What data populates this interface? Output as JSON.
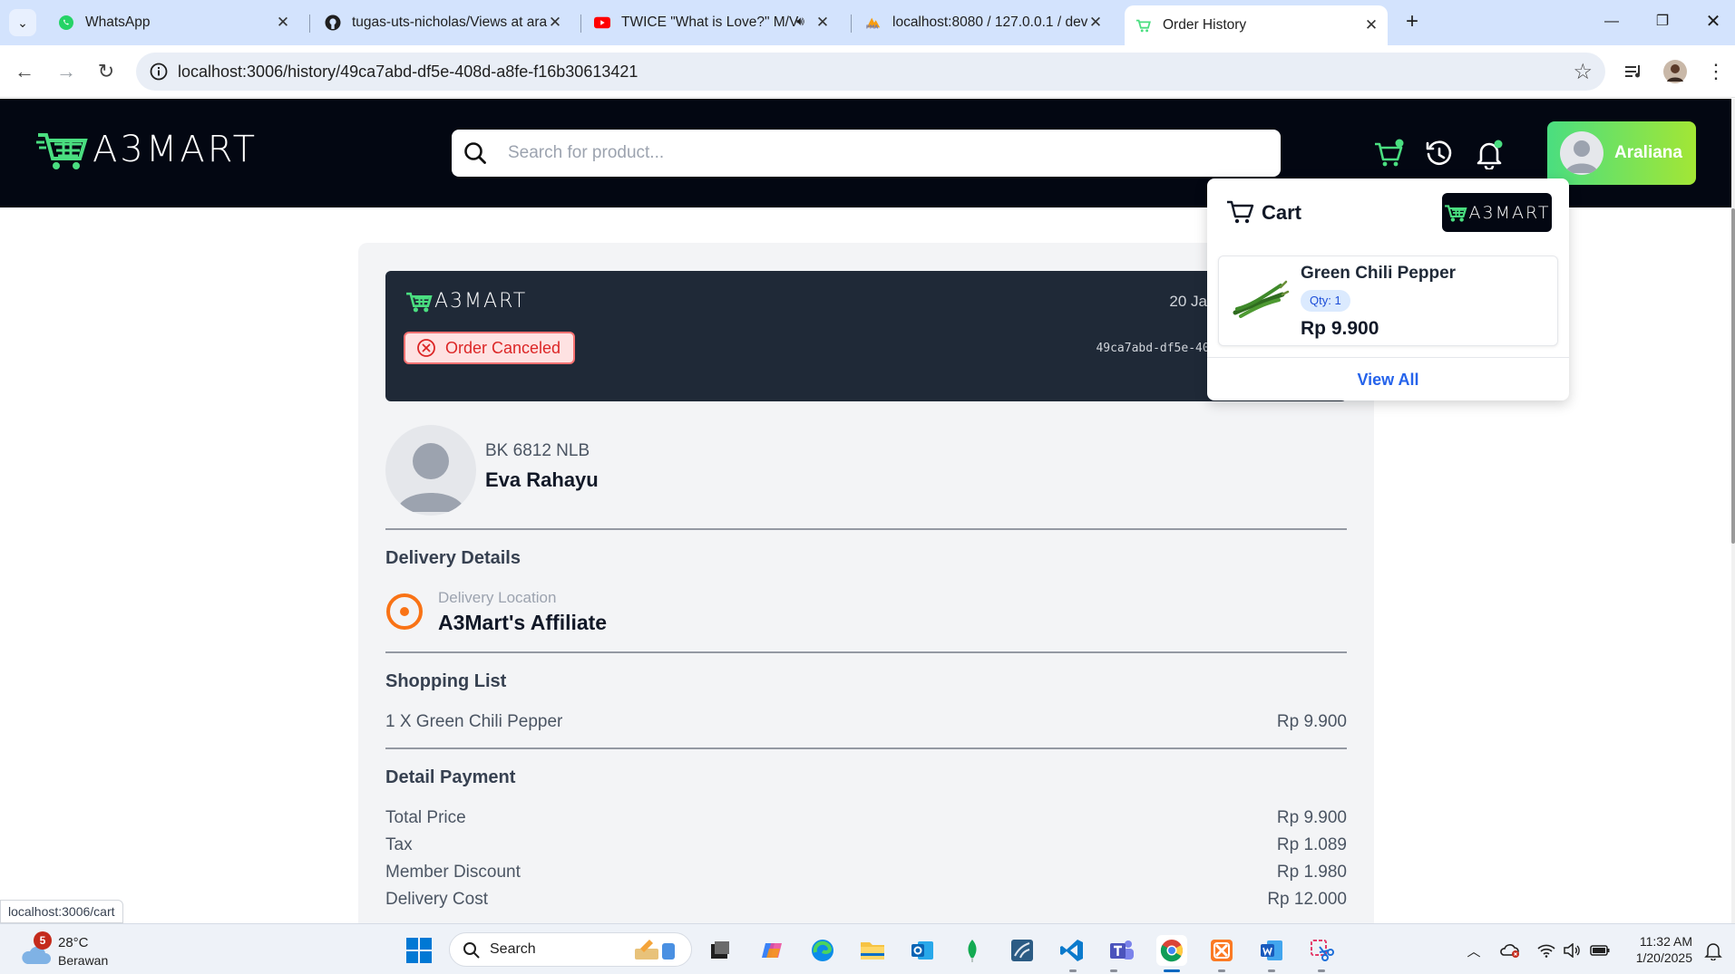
{
  "browser": {
    "tabs": [
      {
        "title": "WhatsApp"
      },
      {
        "title": "tugas-uts-nicholas/Views at ara"
      },
      {
        "title": "TWICE \"What is Love?\" M/V"
      },
      {
        "title": "localhost:8080 / 127.0.0.1 / dev"
      },
      {
        "title": "Order History"
      }
    ],
    "url": "localhost:3006/history/49ca7abd-df5e-408d-a8fe-f16b30613421",
    "status_url": "localhost:3006/cart"
  },
  "app": {
    "logo_text": "A3MART",
    "search_placeholder": "Search for product...",
    "user_name": "Araliana"
  },
  "order": {
    "logo_text": "A3MART",
    "date": "20 Januar",
    "id": "49ca7abd-df5e-408d-a",
    "status": "Order Canceled",
    "plate": "BK 6812 NLB",
    "driver_name": "Eva Rahayu",
    "delivery_title": "Delivery Details",
    "location_label": "Delivery Location",
    "location_value": "A3Mart's Affiliate",
    "shopping_title": "Shopping List",
    "items": [
      {
        "label": "1 X Green Chili Pepper",
        "price": "Rp 9.900"
      }
    ],
    "payment_title": "Detail Payment",
    "payment": [
      {
        "label": "Total Price",
        "value": "Rp 9.900"
      },
      {
        "label": "Tax",
        "value": "Rp 1.089"
      },
      {
        "label": "Member Discount",
        "value": "Rp 1.980"
      },
      {
        "label": "Delivery Cost",
        "value": "Rp 12.000"
      }
    ]
  },
  "cart": {
    "title": "Cart",
    "logo_text": "A3MART",
    "item_name": "Green Chili Pepper",
    "item_qty": "Qty: 1",
    "item_price": "Rp 9.900",
    "view_all": "View All"
  },
  "taskbar": {
    "weather_badge": "5",
    "temperature": "28°C",
    "condition": "Berawan",
    "search_label": "Search",
    "time": "11:32 AM",
    "date": "1/20/2025"
  },
  "colors": {
    "brand_green": "#4ade80",
    "header_dark": "#030712",
    "order_head": "#1f2937",
    "canceled_red": "#dc2626",
    "location_orange": "#f97316",
    "link_blue": "#2563eb"
  }
}
